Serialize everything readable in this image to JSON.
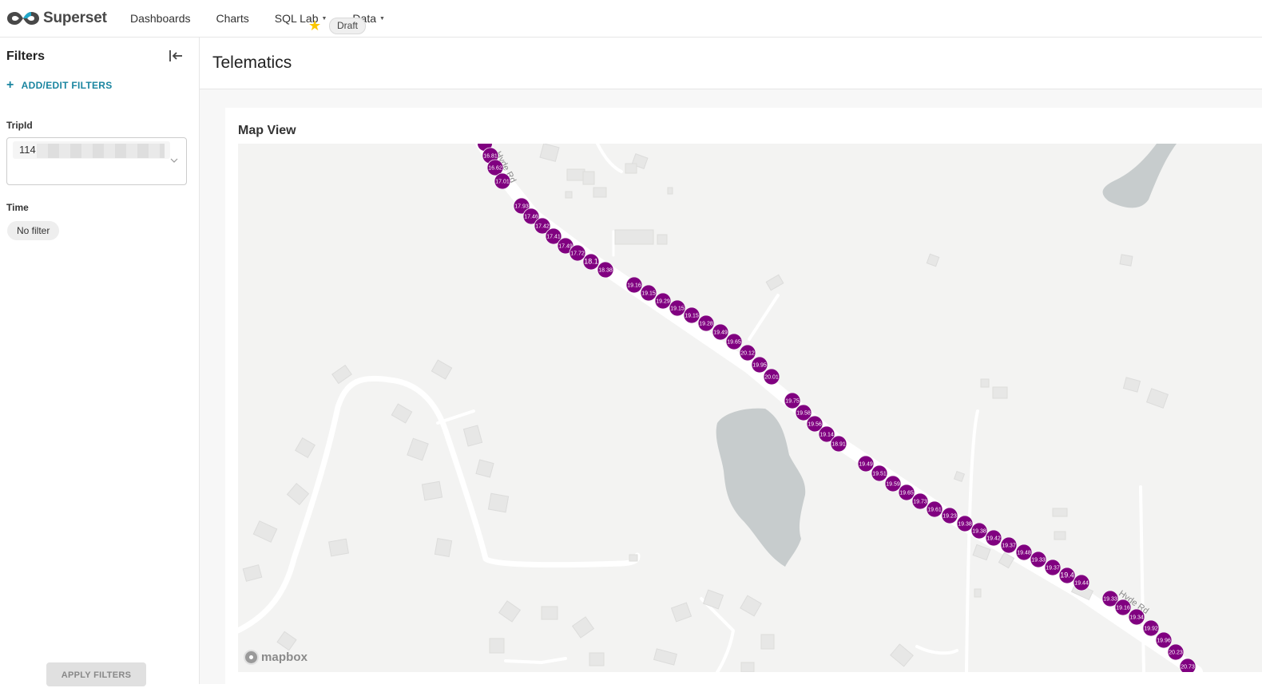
{
  "app": {
    "brand": "Superset",
    "nav": [
      {
        "label": "Dashboards"
      },
      {
        "label": "Charts"
      },
      {
        "label": "SQL Lab",
        "dropdown": true
      },
      {
        "label": "Data",
        "dropdown": true
      }
    ]
  },
  "sidebar": {
    "title": "Filters",
    "add_edit_label": "ADD/EDIT FILTERS",
    "filters": [
      {
        "label": "TripId",
        "value": "114"
      },
      {
        "label": "Time",
        "value": "No filter"
      }
    ],
    "apply_label": "APPLY FILTERS"
  },
  "dashboard": {
    "title": "Telematics",
    "starred": true,
    "status_badge": "Draft"
  },
  "chart": {
    "title": "Map View",
    "attribution": "mapbox",
    "road_labels": [
      "Hyde Rd",
      "Hyde Rd"
    ],
    "point_color": "#800080",
    "background_color": "#f3f3f2",
    "water_color": "#c7cccd",
    "point_values": [
      "16.81",
      "16.62",
      "17.01",
      "17.93",
      "17.46",
      "17.42",
      "17.41",
      "17.49",
      "17.72",
      "18.1",
      "18.38",
      "19.16",
      "19.15",
      "19.29",
      "19.15",
      "19.15",
      "19.28",
      "19.49",
      "19.65",
      "20.12",
      "19.95",
      "20.01",
      "19.75",
      "19.58",
      "19.56",
      "19.14",
      "18.91",
      "19.49",
      "19.51",
      "19.59",
      "19.65",
      "19.73",
      "19.61",
      "19.23",
      "19.38",
      "19.38",
      "19.42",
      "19.37",
      "19.48",
      "19.33",
      "19.37",
      "19.4",
      "19.44",
      "19.33",
      "19.16",
      "19.34",
      "19.92",
      "19.96",
      "20.23",
      "20.73"
    ]
  },
  "colors": {
    "accent": "#1a85a0",
    "star": "#fbc700"
  }
}
